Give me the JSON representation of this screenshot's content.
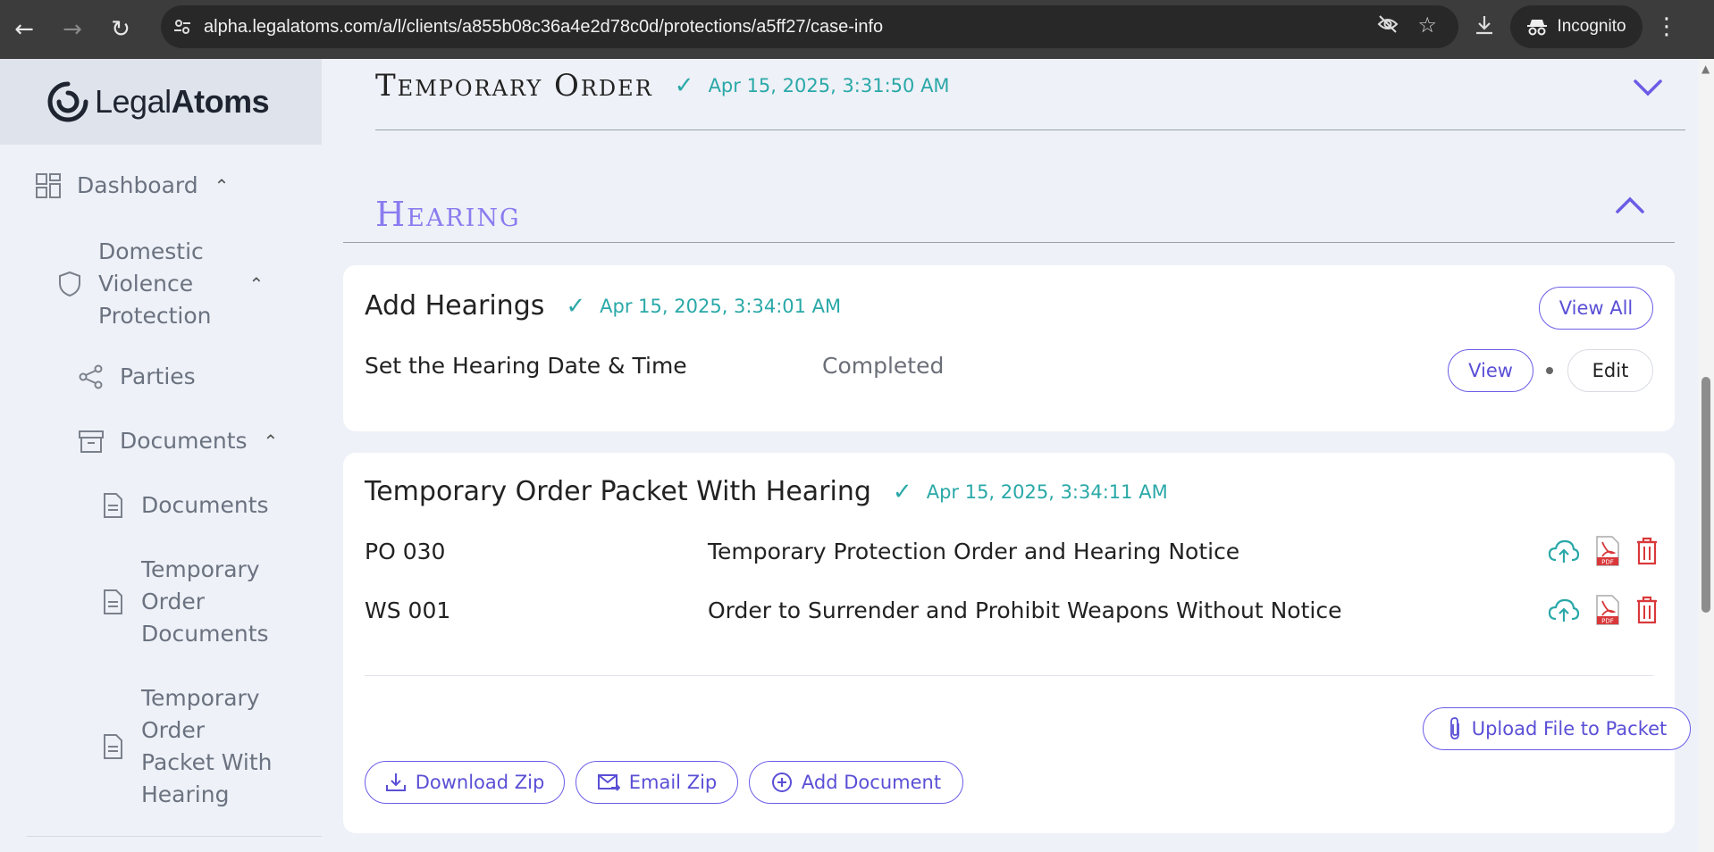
{
  "browser": {
    "url": "alpha.legalatoms.com/a/l/clients/a855b08c36a4e2d78c0d/protections/a5ff27/case-info",
    "incognito_label": "Incognito"
  },
  "sidebar": {
    "logo_light": "Legal",
    "logo_bold": "Atoms",
    "dashboard": "Dashboard",
    "protection_line1": "Domestic",
    "protection_line2": "Violence",
    "protection_line3": "Protection",
    "parties": "Parties",
    "documents_group": "Documents",
    "documents_item": "Documents",
    "temp_docs_line1": "Temporary",
    "temp_docs_line2": "Order",
    "temp_docs_line3": "Documents",
    "temp_packet_line1": "Temporary",
    "temp_packet_line2": "Order",
    "temp_packet_line3": "Packet With",
    "temp_packet_line4": "Hearing"
  },
  "sections": {
    "temporary_order": {
      "title": "Temporary Order",
      "timestamp": "Apr 15, 2025, 3:31:50 AM"
    },
    "hearing": {
      "title": "Hearing"
    }
  },
  "add_hearings": {
    "title": "Add Hearings",
    "timestamp": "Apr 15, 2025, 3:34:01 AM",
    "view_all_label": "View All",
    "row_label": "Set the Hearing Date & Time",
    "row_status": "Completed",
    "view_label": "View",
    "edit_label": "Edit"
  },
  "packet": {
    "title": "Temporary Order Packet With Hearing",
    "timestamp": "Apr 15, 2025, 3:34:11 AM",
    "documents": [
      {
        "code": "PO 030",
        "name": "Temporary Protection Order and Hearing Notice"
      },
      {
        "code": "WS 001",
        "name": "Order to Surrender and Prohibit Weapons Without Notice"
      }
    ],
    "pdf_label": "PDF",
    "upload_label": "Upload File to Packet",
    "download_zip_label": "Download Zip",
    "email_zip_label": "Email Zip",
    "add_document_label": "Add Document"
  },
  "colors": {
    "accent": "#6b5ce7",
    "teal": "#2aa8a8",
    "danger": "#d9383a"
  }
}
